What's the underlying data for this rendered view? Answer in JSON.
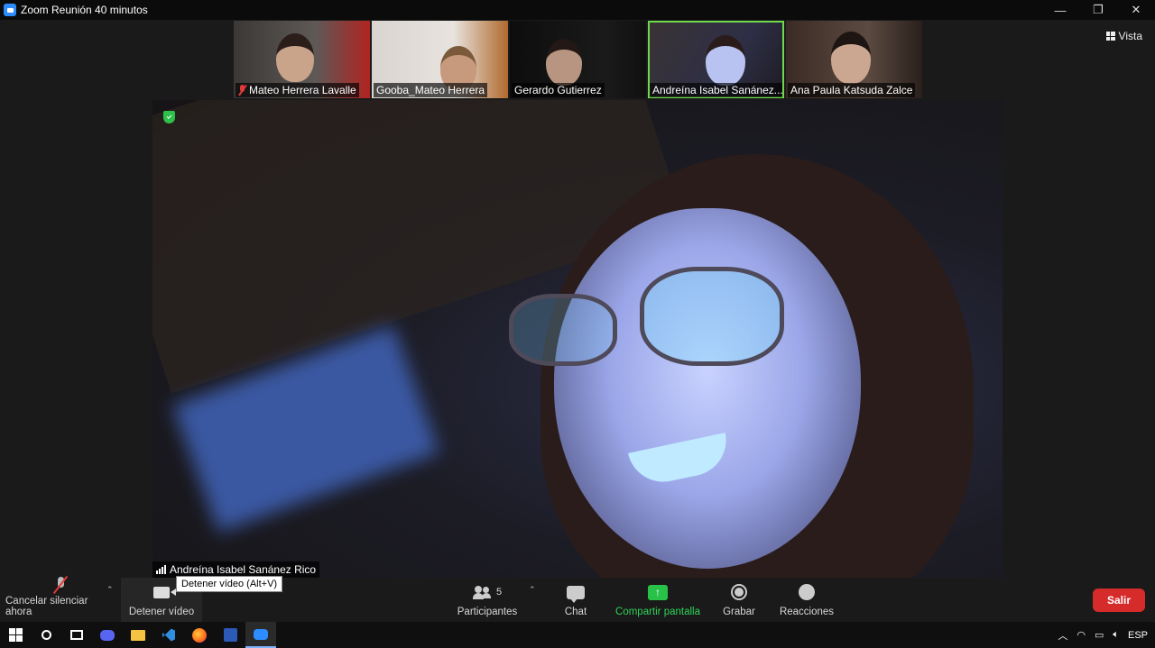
{
  "window": {
    "title": "Zoom Reunión 40 minutos"
  },
  "view_button": {
    "label": "Vista"
  },
  "participants_strip": [
    {
      "name": "Mateo Herrera Lavalle",
      "muted": true
    },
    {
      "name": "Gooba_Mateo Herrera",
      "muted": false
    },
    {
      "name": "Gerardo Gutierrez",
      "muted": false
    },
    {
      "name": "Andreína Isabel Sanánez...",
      "muted": false,
      "active": true
    },
    {
      "name": "Ana Paula Katsuda Zalce",
      "muted": false
    }
  ],
  "main_video": {
    "speaker_name": "Andreína Isabel Sanánez Rico"
  },
  "toolbar": {
    "mute_label": "Cancelar silenciar ahora",
    "video_label": "Detener vídeo",
    "video_tooltip": "Detener vídeo (Alt+V)",
    "participants_label": "Participantes",
    "participants_count": "5",
    "chat_label": "Chat",
    "share_label": "Compartir pantalla",
    "record_label": "Grabar",
    "reactions_label": "Reacciones",
    "leave_label": "Salir"
  },
  "taskbar": {
    "language": "ESP"
  },
  "colors": {
    "share_green": "#29c249",
    "leave_red": "#d52b2b",
    "active_border": "#6fd94d"
  }
}
